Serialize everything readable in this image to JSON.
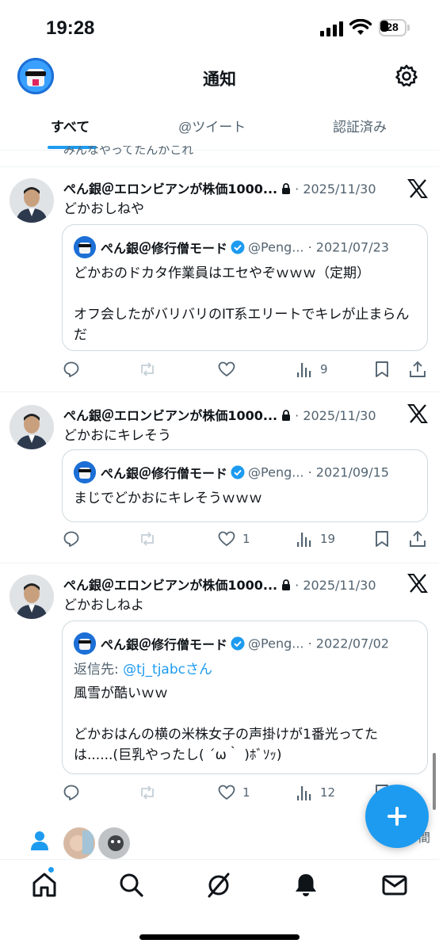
{
  "status": {
    "time": "19:28",
    "battery": "28"
  },
  "header": {
    "title": "通知",
    "settings_icon": "gear-icon"
  },
  "tabs": [
    {
      "label": "すべて",
      "active": true
    },
    {
      "label": "@ツイート",
      "active": false
    },
    {
      "label": "認証済み",
      "active": false
    }
  ],
  "cut_text": "みんなやってたんかこれ",
  "tweets": [
    {
      "name": "ぺん銀＠エロンビアンが株価1000...",
      "date": "· 2025/11/30",
      "text": "どかおしねや",
      "quote": {
        "name": "ぺん銀＠修行僧モード",
        "handle": "@Peng...",
        "date": "· 2021/07/23",
        "reply_to": "",
        "mention": "",
        "reply_suffix": "",
        "lines": [
          "どかおのドカタ作業員はエセやぞｗｗｗ（定期）",
          "",
          "オフ会したがバリバリのIT系エリートでキレが止まらんだ"
        ]
      },
      "likes": "",
      "views": "9"
    },
    {
      "name": "ぺん銀＠エロンビアンが株価1000...",
      "date": "· 2025/11/30",
      "text": "どかおにキレそう",
      "quote": {
        "name": "ぺん銀＠修行僧モード",
        "handle": "@Peng...",
        "date": "· 2021/09/15",
        "reply_to": "",
        "mention": "",
        "reply_suffix": "",
        "lines": [
          "まじでどかおにキレそうｗｗｗ"
        ]
      },
      "likes": "1",
      "views": "19"
    },
    {
      "name": "ぺん銀＠エロンビアンが株価1000...",
      "date": "· 2025/11/30",
      "text": "どかおしねよ",
      "quote": {
        "name": "ぺん銀＠修行僧モード",
        "handle": "@Peng...",
        "date": "· 2022/07/02",
        "reply_to": "返信先: ",
        "mention": "@tj_tjabc",
        "reply_suffix": "さん",
        "lines": [
          "風雪が酷いｗｗ",
          "",
          "どかおはんの横の米株女子の声掛けが1番光ってたは......(巨乳やったし( ´ω｀ )ﾎﾞｿｯ)"
        ]
      },
      "likes": "1",
      "views": "12"
    }
  ],
  "partial_text": "間",
  "colors": {
    "accent": "#1d9bf0",
    "text": "#0f1419",
    "secondary": "#536471"
  }
}
